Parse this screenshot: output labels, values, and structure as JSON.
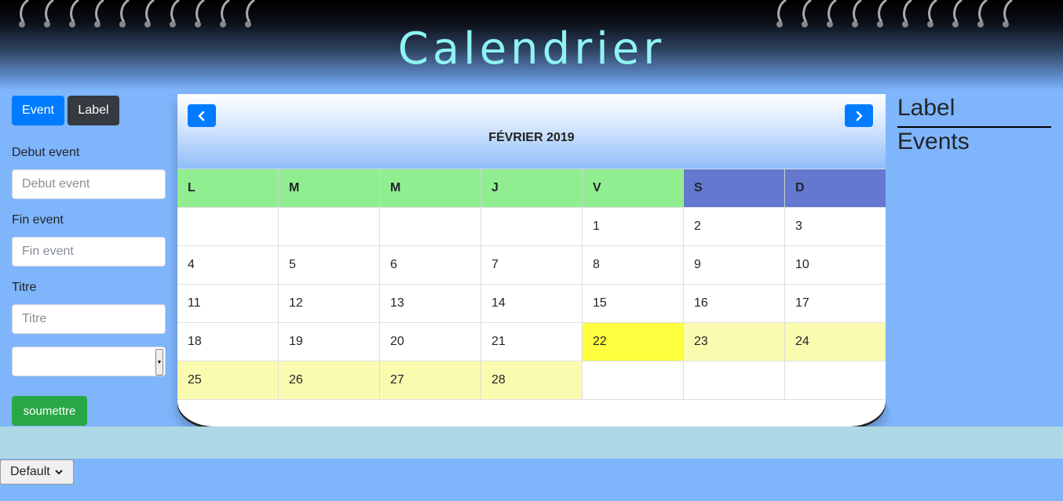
{
  "header": {
    "title": "Calendrier"
  },
  "left_panel": {
    "tab_event": "Event",
    "tab_label": "Label",
    "debut_label": "Debut event",
    "debut_placeholder": "Debut event",
    "fin_label": "Fin event",
    "fin_placeholder": "Fin event",
    "titre_label": "Titre",
    "titre_placeholder": "Titre",
    "select_value": "",
    "submit_label": "soumettre"
  },
  "calendar": {
    "month_title": "FÉVRIER 2019",
    "weekdays": [
      "L",
      "M",
      "M",
      "J",
      "V",
      "S",
      "D"
    ],
    "weeks": [
      [
        "",
        "",
        "",
        "",
        "1",
        "2",
        "3"
      ],
      [
        "4",
        "5",
        "6",
        "7",
        "8",
        "9",
        "10"
      ],
      [
        "11",
        "12",
        "13",
        "14",
        "15",
        "16",
        "17"
      ],
      [
        "18",
        "19",
        "20",
        "21",
        "22",
        "23",
        "24"
      ],
      [
        "25",
        "26",
        "27",
        "28",
        "",
        "",
        ""
      ]
    ],
    "today": "22",
    "colors": {
      "weekday_header": "#90ee90",
      "weekend_header": "#6478d0",
      "today": "#ffff40",
      "current_week_strip": "#fbfbb0"
    }
  },
  "right_panel": {
    "label_heading": "Label",
    "events_heading": "Events"
  },
  "footer": {
    "theme_select_value": "Default"
  }
}
